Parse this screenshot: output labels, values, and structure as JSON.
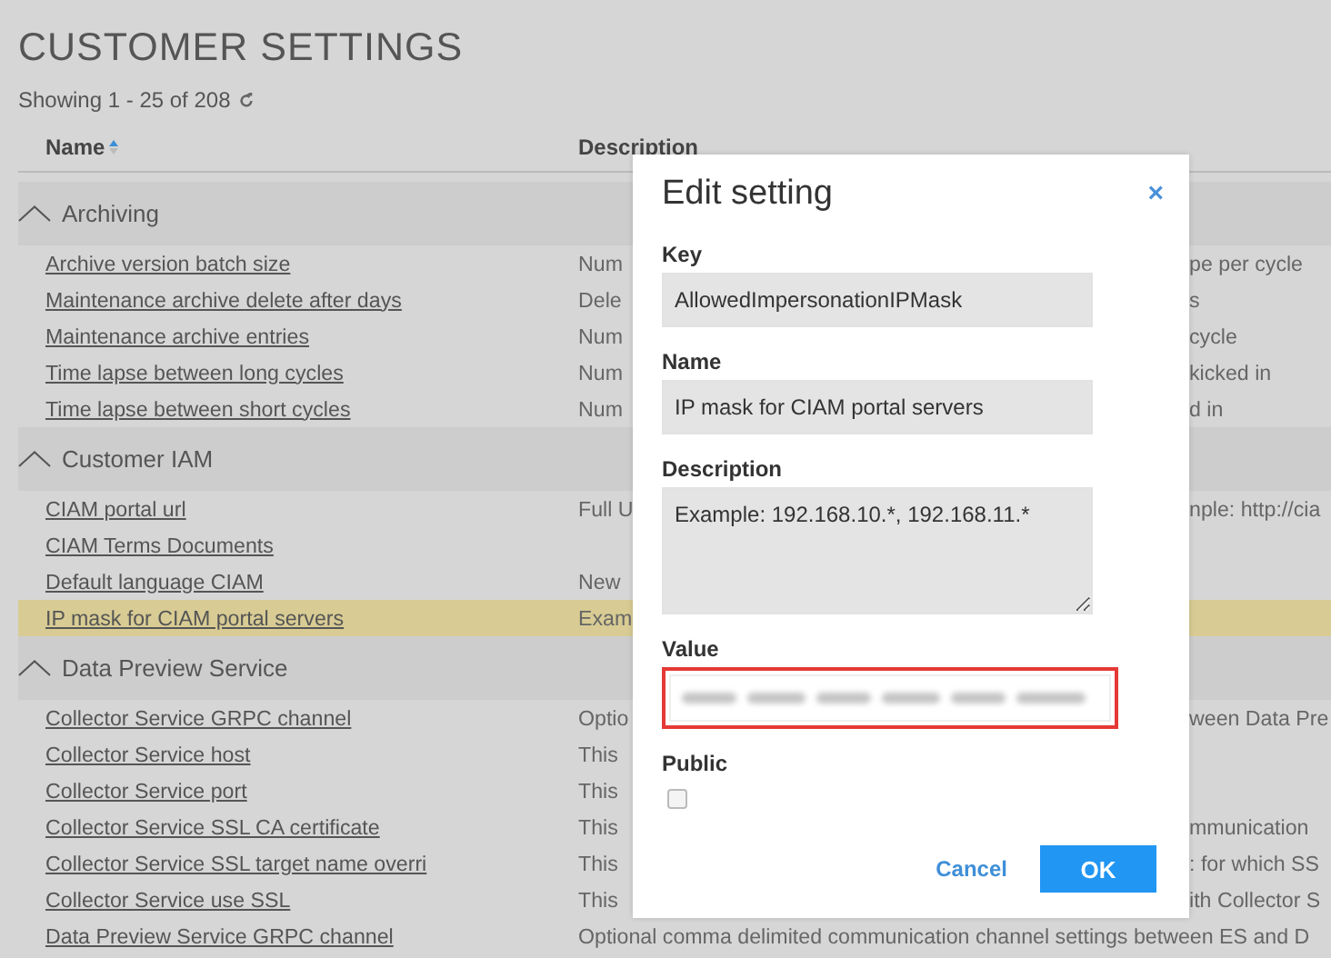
{
  "page": {
    "title": "CUSTOMER SETTINGS",
    "showing": "Showing 1 - 25 of 208"
  },
  "table": {
    "columns": [
      {
        "label": "Name",
        "sort_ascending": true
      },
      {
        "label": "Description",
        "sort_ascending": false
      }
    ],
    "groups": [
      {
        "name": "Archiving",
        "expanded": true,
        "rows": [
          {
            "name": "Archive version batch size",
            "description_left": "Num",
            "description_right": "pe per cycle",
            "selected": false
          },
          {
            "name": "Maintenance archive delete after days",
            "description_left": "Dele",
            "description_right": "s",
            "selected": false
          },
          {
            "name": "Maintenance archive entries",
            "description_left": "Num",
            "description_right": "cycle",
            "selected": false
          },
          {
            "name": "Time lapse between long cycles",
            "description_left": "Num",
            "description_right": "kicked in",
            "selected": false
          },
          {
            "name": "Time lapse between short cycles",
            "description_left": "Num",
            "description_right": "d in",
            "selected": false
          }
        ]
      },
      {
        "name": "Customer IAM",
        "expanded": true,
        "rows": [
          {
            "name": "CIAM portal url",
            "description_left": "Full U",
            "description_right": "nple: http://cia",
            "selected": false
          },
          {
            "name": "CIAM Terms Documents",
            "selected": false
          },
          {
            "name": "Default language CIAM",
            "description_left": "New",
            "selected": false
          },
          {
            "name": "IP mask for CIAM portal servers",
            "description_left": "Exam",
            "selected": true
          }
        ]
      },
      {
        "name": "Data Preview Service",
        "expanded": true,
        "rows": [
          {
            "name": "Collector Service GRPC channel",
            "description_left": "Optio",
            "description_right": "ween Data Pre",
            "selected": false
          },
          {
            "name": "Collector Service host",
            "description_left": "This",
            "selected": false
          },
          {
            "name": "Collector Service port",
            "description_left": "This",
            "selected": false
          },
          {
            "name": "Collector Service SSL CA certificate",
            "description_left": "This",
            "description_right": "mmunication",
            "selected": false
          },
          {
            "name": "Collector Service SSL target name overri",
            "description_left": "This",
            "description_right": ": for which SS",
            "selected": false
          },
          {
            "name": "Collector Service use SSL",
            "description_left": "This",
            "description_right": "ith Collector S",
            "selected": false
          },
          {
            "name": "Data Preview Service GRPC channel",
            "description": "Optional comma delimited communication channel settings between ES and D",
            "selected": false
          }
        ]
      }
    ]
  },
  "dialog": {
    "title": "Edit setting",
    "close": "×",
    "fields": [
      {
        "kind": "text",
        "label": "Key",
        "value": "AllowedImpersonationIPMask"
      },
      {
        "kind": "text",
        "label": "Name",
        "value": "IP mask for CIAM portal servers"
      },
      {
        "kind": "textarea",
        "label": "Description",
        "value": "Example: 192.168.10.*, 192.168.11.*"
      },
      {
        "kind": "redacted",
        "label": "Value",
        "highlighted": true
      },
      {
        "kind": "checkbox",
        "label": "Public",
        "checked": false
      }
    ],
    "buttons": [
      {
        "label": "Cancel",
        "kind": "link"
      },
      {
        "label": "OK",
        "kind": "primary"
      }
    ]
  }
}
